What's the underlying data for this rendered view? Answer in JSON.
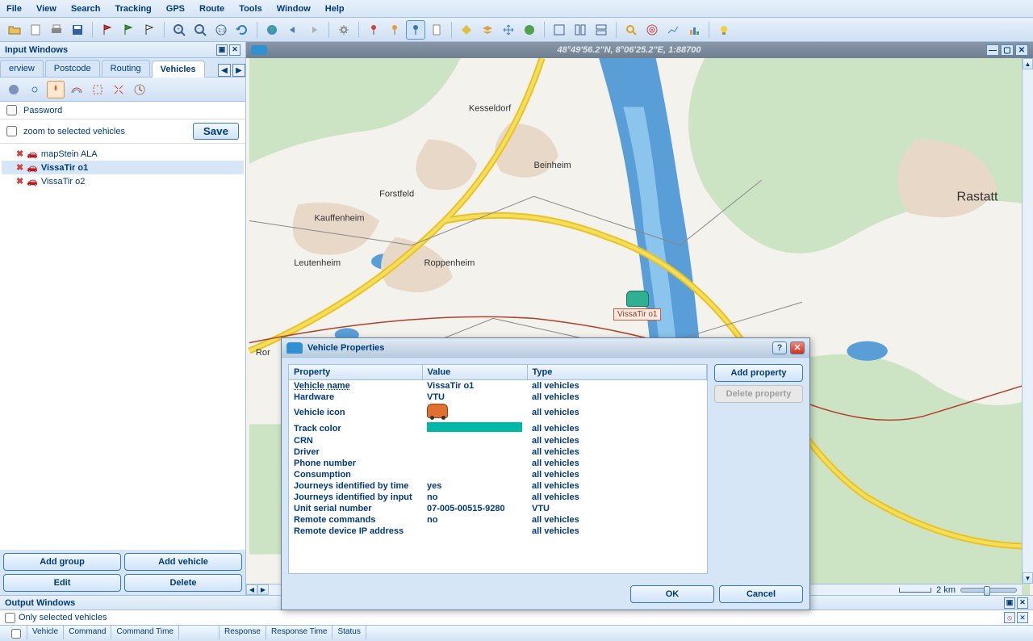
{
  "menu": [
    "File",
    "View",
    "Search",
    "Tracking",
    "GPS",
    "Route",
    "Tools",
    "Window",
    "Help"
  ],
  "input_panel": {
    "title": "Input Windows",
    "tabs": [
      "erview",
      "Postcode",
      "Routing",
      "Vehicles"
    ],
    "active_tab": 3,
    "password_label": "Password",
    "zoom_label": "zoom to selected vehicles",
    "save_label": "Save",
    "vehicles": [
      {
        "name": "mapStein ALA",
        "selected": false
      },
      {
        "name": "VissaTir o1",
        "selected": true
      },
      {
        "name": "VissaTir o2",
        "selected": false
      }
    ],
    "buttons": {
      "add_group": "Add group",
      "add_vehicle": "Add vehicle",
      "edit": "Edit",
      "delete": "Delete"
    }
  },
  "map": {
    "coords": "48°49'56.2\"N, 8°06'25.2\"E, 1:88700",
    "scale_label": "2 km",
    "places": {
      "kesseldorf": "Kesseldorf",
      "beinheim": "Beinheim",
      "forstfeld": "Forstfeld",
      "kauffenheim": "Kauffenheim",
      "leutenheim": "Leutenheim",
      "roppenheim": "Roppenheim",
      "rastatt": "Rastatt",
      "ror": "Ror"
    },
    "marker_label": "VissaTir o1"
  },
  "output_panel": {
    "title": "Output Windows",
    "only_selected": "Only selected vehicles",
    "columns": [
      "Vehicle",
      "Command",
      "Command Time",
      "Response",
      "Response Time",
      "Status"
    ]
  },
  "dialog": {
    "title": "Vehicle Properties",
    "headers": {
      "property": "Property",
      "value": "Value",
      "type": "Type"
    },
    "type_all": "all vehicles",
    "type_vtu": "VTU",
    "rows": [
      {
        "prop": "Vehicle name",
        "val": "VissaTir o1",
        "type": "all vehicles",
        "underline": true
      },
      {
        "prop": "Hardware",
        "val": "VTU",
        "type": "all vehicles"
      },
      {
        "prop": "Vehicle icon",
        "val": "__ICON__",
        "type": "all vehicles"
      },
      {
        "prop": "Track color",
        "val": "__COLOR__",
        "type": "all vehicles"
      },
      {
        "prop": "CRN",
        "val": "",
        "type": "all vehicles"
      },
      {
        "prop": "Driver",
        "val": "",
        "type": "all vehicles"
      },
      {
        "prop": "Phone number",
        "val": "",
        "type": "all vehicles"
      },
      {
        "prop": "Consumption",
        "val": "",
        "type": "all vehicles"
      },
      {
        "prop": "Journeys identified by time",
        "val": "yes",
        "type": "all vehicles"
      },
      {
        "prop": "Journeys identified by input",
        "val": "no",
        "type": "all vehicles"
      },
      {
        "prop": "Unit serial number",
        "val": "07-005-00515-9280",
        "type": "VTU"
      },
      {
        "prop": "Remote commands",
        "val": "no",
        "type": "all vehicles"
      },
      {
        "prop": "Remote device IP address",
        "val": "",
        "type": "all vehicles"
      }
    ],
    "buttons": {
      "add_property": "Add property",
      "delete_property": "Delete property",
      "ok": "OK",
      "cancel": "Cancel"
    }
  },
  "colors": {
    "track": "#00b8a8"
  }
}
